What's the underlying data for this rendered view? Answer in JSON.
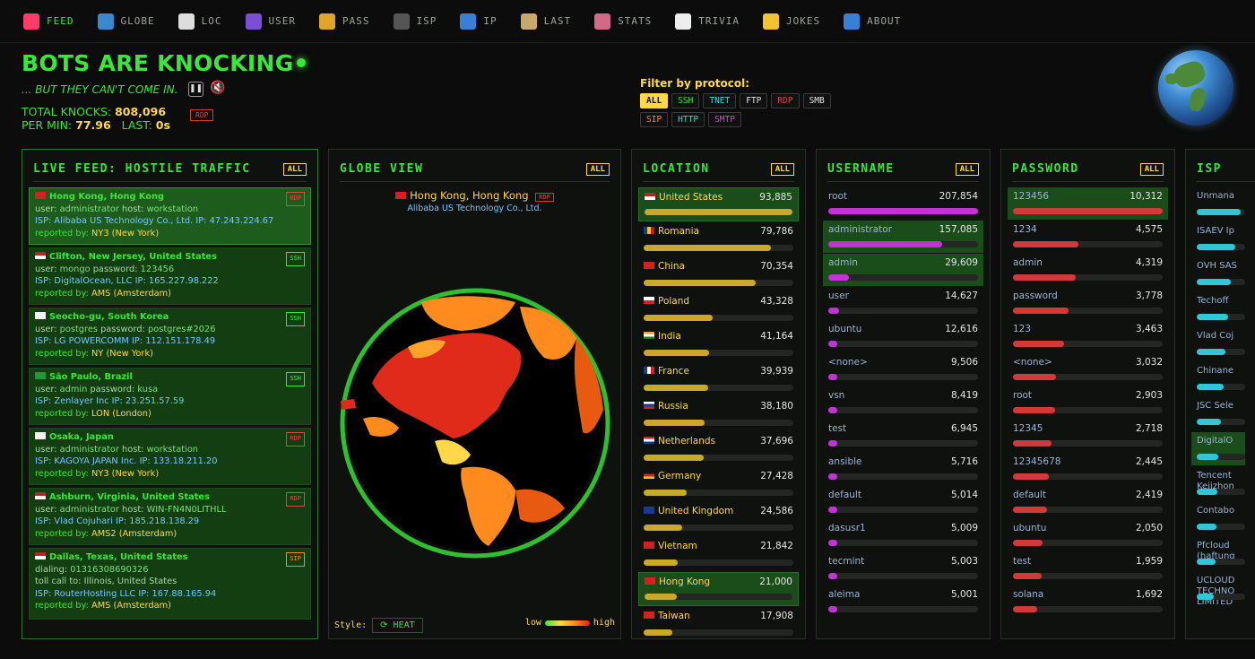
{
  "nav": [
    {
      "label": "FEED",
      "icon": "megaphone-icon",
      "color": "#ff3b6b",
      "active": true
    },
    {
      "label": "GLOBE",
      "icon": "globe-icon",
      "color": "#3b88cf"
    },
    {
      "label": "LOC",
      "icon": "flag-icon",
      "color": "#dddddd"
    },
    {
      "label": "USER",
      "icon": "user-icon",
      "color": "#7a4fd6"
    },
    {
      "label": "PASS",
      "icon": "key-icon",
      "color": "#e0a526"
    },
    {
      "label": "ISP",
      "icon": "plug-icon",
      "color": "#555555"
    },
    {
      "label": "IP",
      "icon": "numbers-icon",
      "color": "#3a7fd6"
    },
    {
      "label": "LAST",
      "icon": "clipboard-icon",
      "color": "#c9a86b"
    },
    {
      "label": "STATS",
      "icon": "bar-chart-icon",
      "color": "#d06a8a"
    },
    {
      "label": "TRIVIA",
      "icon": "dice-icon",
      "color": "#eeeeee"
    },
    {
      "label": "JOKES",
      "icon": "laugh-icon",
      "color": "#f2c230"
    },
    {
      "label": "ABOUT",
      "icon": "info-icon",
      "color": "#3a7fd6"
    }
  ],
  "header": {
    "title": "BOTS ARE KNOCKING",
    "subtitle": "... BUT THEY CAN'T COME IN.",
    "total_label": "TOTAL KNOCKS:",
    "total_value": "808,096",
    "rate_label": "PER MIN:",
    "rate_value": "77.96",
    "last_label": "LAST:",
    "last_value": "0s",
    "last_proto": "RDP"
  },
  "filter": {
    "label": "Filter by protocol:",
    "chips": [
      {
        "label": "ALL",
        "color": "#ffd84a",
        "active": true
      },
      {
        "label": "SSH",
        "color": "#39e639"
      },
      {
        "label": "TNET",
        "color": "#3fd6d6"
      },
      {
        "label": "FTP",
        "color": "#e6e6e6"
      },
      {
        "label": "RDP",
        "color": "#e04545"
      },
      {
        "label": "SMB",
        "color": "#e6e6e6"
      },
      {
        "label": "SIP",
        "color": "#ff8a1d"
      },
      {
        "label": "HTTP",
        "color": "#3fd6b0"
      },
      {
        "label": "SMTP",
        "color": "#d63fd6"
      }
    ]
  },
  "feed": {
    "title": "LIVE FEED: HOSTILE TRAFFIC",
    "all_label": "ALL",
    "items": [
      {
        "flag": "hk",
        "loc": "Hong Kong, Hong Kong",
        "l2k": "user: ",
        "l2v": "administrator",
        "l2k2": "host: ",
        "l2v2": "workstation",
        "isp": "ISP: Alibaba US Technology Co., Ltd.   IP: 47.243.224.67",
        "rep_label": "reported by: ",
        "rep": "NY3 (New York)",
        "proto": "RDP",
        "pcolor": "#e04545"
      },
      {
        "flag": "us",
        "loc": "Clifton, New Jersey, United States",
        "l2k": "user: ",
        "l2v": "mongo",
        "l2k2": "password: ",
        "l2v2": "123456",
        "isp": "ISP: DigitalOcean, LLC   IP: 165.227.98.222",
        "rep_label": "reported by: ",
        "rep": "AMS (Amsterdam)",
        "proto": "SSH",
        "pcolor": "#39e639"
      },
      {
        "flag": "kr",
        "loc": "Seocho-gu, South Korea",
        "l2k": "user: ",
        "l2v": "postgres",
        "l2k2": "password: ",
        "l2v2": "postgres#2026",
        "isp": "ISP: LG POWERCOMM   IP: 112.151.178.49",
        "rep_label": "reported by: ",
        "rep": "NY (New York)",
        "proto": "SSH",
        "pcolor": "#39e639"
      },
      {
        "flag": "br",
        "loc": "São Paulo, Brazil",
        "l2k": "user: ",
        "l2v": "admin",
        "l2k2": "password: ",
        "l2v2": "kusa",
        "isp": "ISP: Zenlayer Inc   IP: 23.251.57.59",
        "rep_label": "reported by: ",
        "rep": "LON (London)",
        "proto": "SSH",
        "pcolor": "#39e639"
      },
      {
        "flag": "jp",
        "loc": "Osaka, Japan",
        "l2k": "user: ",
        "l2v": "administrator",
        "l2k2": "host: ",
        "l2v2": "workstation",
        "isp": "ISP: KAGOYA JAPAN Inc.   IP: 133.18.211.20",
        "rep_label": "reported by: ",
        "rep": "NY3 (New York)",
        "proto": "RDP",
        "pcolor": "#e04545"
      },
      {
        "flag": "us",
        "loc": "Ashburn, Virginia, United States",
        "l2k": "user: ",
        "l2v": "administrator",
        "l2k2": "host: ",
        "l2v2": "WIN-FN4N0LITHLL",
        "isp": "ISP: Vlad Cojuhari   IP: 185.218.138.29",
        "rep_label": "reported by: ",
        "rep": "AMS2 (Amsterdam)",
        "proto": "RDP",
        "pcolor": "#e04545"
      },
      {
        "flag": "us",
        "loc": "Dallas, Texas, United States",
        "l2k": "dialing: ",
        "l2v": "01316308690326",
        "l2k2": "",
        "l2v2": "",
        "l3": "toll call to: Illinois, United States",
        "isp": "ISP: RouterHosting LLC   IP: 167.88.165.94",
        "rep_label": "reported by: ",
        "rep": "AMS (Amsterdam)",
        "proto": "SIP",
        "pcolor": "#ff8a1d"
      }
    ]
  },
  "globe": {
    "title": "GLOBE VIEW",
    "all_label": "ALL",
    "loc": "Hong Kong, Hong Kong",
    "proto": "RDP",
    "isp": "Alibaba US Technology Co., Ltd.",
    "style_label": "Style:",
    "style_value": "HEAT",
    "legend_low": "low",
    "legend_high": "high"
  },
  "location": {
    "title": "LOCATION",
    "all_label": "ALL",
    "rows": [
      {
        "flag": "us",
        "name": "United States",
        "count": "93,885",
        "pct": 100,
        "hl": true
      },
      {
        "flag": "ro",
        "name": "Romania",
        "count": "79,786",
        "pct": 85
      },
      {
        "flag": "cn",
        "name": "China",
        "count": "70,354",
        "pct": 75
      },
      {
        "flag": "pl",
        "name": "Poland",
        "count": "43,328",
        "pct": 46
      },
      {
        "flag": "in",
        "name": "India",
        "count": "41,164",
        "pct": 44
      },
      {
        "flag": "fr",
        "name": "France",
        "count": "39,939",
        "pct": 43
      },
      {
        "flag": "ru",
        "name": "Russia",
        "count": "38,180",
        "pct": 41
      },
      {
        "flag": "nl",
        "name": "Netherlands",
        "count": "37,696",
        "pct": 40
      },
      {
        "flag": "de",
        "name": "Germany",
        "count": "27,428",
        "pct": 29
      },
      {
        "flag": "gb",
        "name": "United Kingdom",
        "count": "24,586",
        "pct": 26
      },
      {
        "flag": "vn",
        "name": "Vietnam",
        "count": "21,842",
        "pct": 23
      },
      {
        "flag": "hk",
        "name": "Hong Kong",
        "count": "21,000",
        "pct": 22,
        "hl": true
      },
      {
        "flag": "tw",
        "name": "Taiwan",
        "count": "17,908",
        "pct": 19
      }
    ]
  },
  "username": {
    "title": "USERNAME",
    "all_label": "ALL",
    "rows": [
      {
        "name": "root",
        "count": "207,854",
        "pct": 100
      },
      {
        "name": "administrator",
        "count": "157,085",
        "pct": 76,
        "hl": true
      },
      {
        "name": "admin",
        "count": "29,609",
        "pct": 14,
        "hl": true
      },
      {
        "name": "user",
        "count": "14,627",
        "pct": 7
      },
      {
        "name": "ubuntu",
        "count": "12,616",
        "pct": 6
      },
      {
        "name": "<none>",
        "count": "9,506",
        "pct": 5
      },
      {
        "name": "vsn",
        "count": "8,419",
        "pct": 4
      },
      {
        "name": "test",
        "count": "6,945",
        "pct": 3
      },
      {
        "name": "ansible",
        "count": "5,716",
        "pct": 3
      },
      {
        "name": "default",
        "count": "5,014",
        "pct": 2
      },
      {
        "name": "dasusr1",
        "count": "5,009",
        "pct": 2
      },
      {
        "name": "tecmint",
        "count": "5,003",
        "pct": 2
      },
      {
        "name": "aleima",
        "count": "5,001",
        "pct": 2
      }
    ]
  },
  "password": {
    "title": "PASSWORD",
    "all_label": "ALL",
    "rows": [
      {
        "name": "123456",
        "count": "10,312",
        "pct": 100,
        "hl": true
      },
      {
        "name": "1234",
        "count": "4,575",
        "pct": 44
      },
      {
        "name": "admin",
        "count": "4,319",
        "pct": 42
      },
      {
        "name": "password",
        "count": "3,778",
        "pct": 37
      },
      {
        "name": "123",
        "count": "3,463",
        "pct": 34
      },
      {
        "name": "<none>",
        "count": "3,032",
        "pct": 29
      },
      {
        "name": "root",
        "count": "2,903",
        "pct": 28
      },
      {
        "name": "12345",
        "count": "2,718",
        "pct": 26
      },
      {
        "name": "12345678",
        "count": "2,445",
        "pct": 24
      },
      {
        "name": "default",
        "count": "2,419",
        "pct": 23
      },
      {
        "name": "ubuntu",
        "count": "2,050",
        "pct": 20
      },
      {
        "name": "test",
        "count": "1,959",
        "pct": 19
      },
      {
        "name": "solana",
        "count": "1,692",
        "pct": 16
      }
    ]
  },
  "isp": {
    "title": "ISP",
    "rows": [
      {
        "name": "Unmana",
        "pct": 90
      },
      {
        "name": "ISAEV Ip",
        "pct": 80
      },
      {
        "name": "OVH SAS",
        "pct": 70
      },
      {
        "name": "Techoff",
        "pct": 65
      },
      {
        "name": "Vlad Coj",
        "pct": 60
      },
      {
        "name": "Chinane",
        "pct": 55
      },
      {
        "name": "JSC Sele",
        "pct": 50
      },
      {
        "name": "DigitalO",
        "pct": 45,
        "hl": true
      },
      {
        "name": "Tencent Kejizhon",
        "pct": 42
      },
      {
        "name": "Contabo",
        "pct": 40
      },
      {
        "name": "Pfcloud (haftung",
        "pct": 38
      },
      {
        "name": "UCLOUD TECHNO LIMITED",
        "pct": 35
      }
    ]
  },
  "colors": {
    "accent": "#39e639",
    "yellow": "#ffd84a",
    "loc_bar": "#c9a82a",
    "user_bar": "#c233d6",
    "pass_bar": "#d23a3a",
    "isp_bar": "#2fc6d6"
  }
}
